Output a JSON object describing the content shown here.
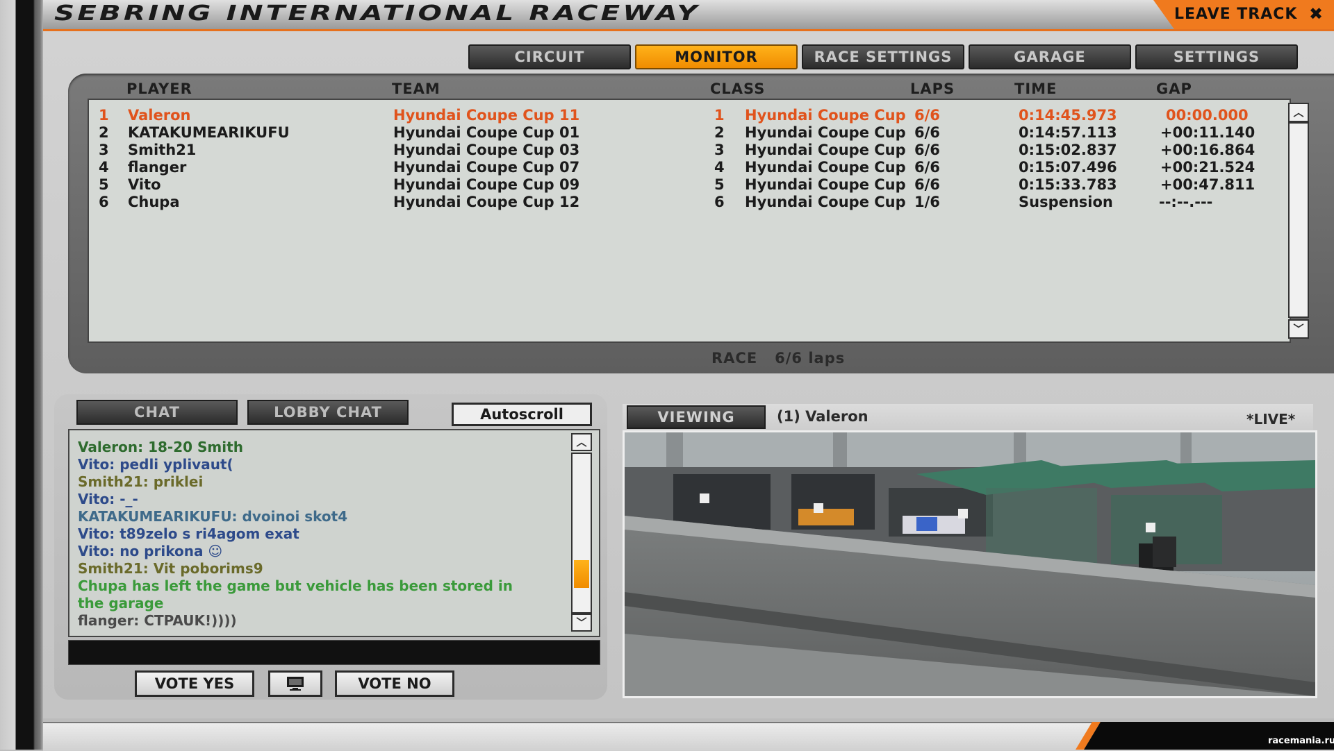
{
  "title": "SEBRING INTERNATIONAL RACEWAY",
  "leave_track": "LEAVE TRACK",
  "tabs": [
    {
      "label": "CIRCUIT"
    },
    {
      "label": "MONITOR"
    },
    {
      "label": "RACE SETTINGS"
    },
    {
      "label": "GARAGE"
    },
    {
      "label": "SETTINGS"
    }
  ],
  "columns": {
    "player": "PLAYER",
    "team": "TEAM",
    "class": "CLASS",
    "laps": "LAPS",
    "time": "TIME",
    "gap": "GAP"
  },
  "results": [
    {
      "pos": "1",
      "player": "Valeron",
      "team": "Hyundai Coupe Cup 11",
      "class_pos": "1",
      "class": "Hyundai Coupe Cup",
      "laps": "6/6",
      "time": "0:14:45.973",
      "gap": "00:00.000"
    },
    {
      "pos": "2",
      "player": "KATAKUMEARIKUFU",
      "team": "Hyundai Coupe Cup 01",
      "class_pos": "2",
      "class": "Hyundai Coupe Cup",
      "laps": "6/6",
      "time": "0:14:57.113",
      "gap": "+00:11.140"
    },
    {
      "pos": "3",
      "player": "Smith21",
      "team": "Hyundai Coupe Cup 03",
      "class_pos": "3",
      "class": "Hyundai Coupe Cup",
      "laps": "6/6",
      "time": "0:15:02.837",
      "gap": "+00:16.864"
    },
    {
      "pos": "4",
      "player": "flanger",
      "team": "Hyundai Coupe Cup 07",
      "class_pos": "4",
      "class": "Hyundai Coupe Cup",
      "laps": "6/6",
      "time": "0:15:07.496",
      "gap": "+00:21.524"
    },
    {
      "pos": "5",
      "player": "Vito",
      "team": "Hyundai Coupe Cup 09",
      "class_pos": "5",
      "class": "Hyundai Coupe Cup",
      "laps": "6/6",
      "time": "0:15:33.783",
      "gap": "+00:47.811"
    },
    {
      "pos": "6",
      "player": "Chupa",
      "team": "Hyundai Coupe Cup 12",
      "class_pos": "6",
      "class": "Hyundai Coupe Cup",
      "laps": "1/6",
      "time": "Suspension",
      "gap": "--:--.---"
    }
  ],
  "race_info": {
    "session": "RACE",
    "laps": "6/6 laps"
  },
  "chat": {
    "tab_chat": "CHAT",
    "tab_lobby": "LOBBY CHAT",
    "autoscroll": "Autoscroll",
    "messages": [
      {
        "text": "Valeron: 18-20 Smith",
        "color": "#2e6b2e"
      },
      {
        "text": "Vito: pedli yplivaut(",
        "color": "#2d4a8a"
      },
      {
        "text": "Smith21: priklei",
        "color": "#6a6a2a"
      },
      {
        "text": "Vito: -_-",
        "color": "#2d4a8a"
      },
      {
        "text": "KATAKUMEARIKUFU: dvoinoi skot4",
        "color": "#3e6a8a"
      },
      {
        "text": "Vito: t89zelo s ri4agom exat",
        "color": "#2d4a8a"
      },
      {
        "text": "Vito: no prikona ☺",
        "color": "#2d4a8a"
      },
      {
        "text": "Smith21: Vit poborims9",
        "color": "#6a6a2a"
      },
      {
        "text": "Chupa has left the game but vehicle has been stored in",
        "color": "#3a9a3a"
      },
      {
        "text": "the garage",
        "color": "#3a9a3a"
      },
      {
        "text": "flanger: CTPAUK!))))",
        "color": "#4a4a4a"
      }
    ],
    "scroll_fraction": 0.82
  },
  "vote": {
    "yes": "VOTE YES",
    "no": "VOTE NO"
  },
  "viewer": {
    "button": "VIEWING",
    "target": "(1) Valeron",
    "live": "*LIVE*"
  },
  "watermark": "racemania.ru",
  "colors": {
    "accent": "#f07a1e",
    "leader": "#e0531c"
  }
}
